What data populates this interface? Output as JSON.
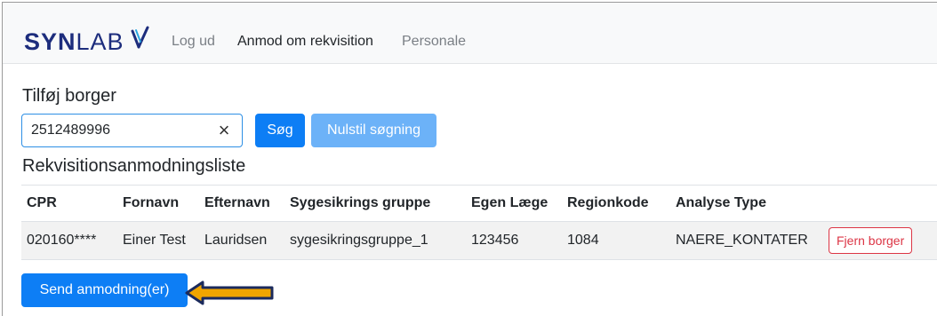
{
  "navbar": {
    "brand_bold": "SYN",
    "brand_light": "LAB",
    "links": [
      {
        "label": "Log ud",
        "active": false
      },
      {
        "label": "Anmod om rekvisition",
        "active": true
      },
      {
        "label": "Personale",
        "active": false
      }
    ]
  },
  "add_citizen": {
    "title": "Tilføj borger",
    "search_value": "2512489996",
    "clear_icon": "×",
    "search_button": "Søg",
    "reset_button": "Nulstil søgning"
  },
  "request_list": {
    "title": "Rekvisitionsanmodningsliste",
    "columns": [
      "CPR",
      "Fornavn",
      "Efternavn",
      "Sygesikrings gruppe",
      "Egen Læge",
      "Regionkode",
      "Analyse Type",
      ""
    ],
    "rows": [
      {
        "cpr": "020160****",
        "first_name": "Einer Test",
        "last_name": "Lauridsen",
        "insurance_group": "sygesikringsgruppe_1",
        "own_doctor": "123456",
        "region_code": "1084",
        "analysis_type": "NAERE_KONTATER",
        "remove_label": "Fjern borger"
      }
    ]
  },
  "send_button": "Send anmodning(er)",
  "colors": {
    "brand": "#1d2d7d",
    "primary": "#0d7ef5",
    "primary_disabled": "#6cb2f8",
    "danger": "#dc3545",
    "arrow_fill": "#f0a500",
    "arrow_outline": "#1b2a5c"
  }
}
